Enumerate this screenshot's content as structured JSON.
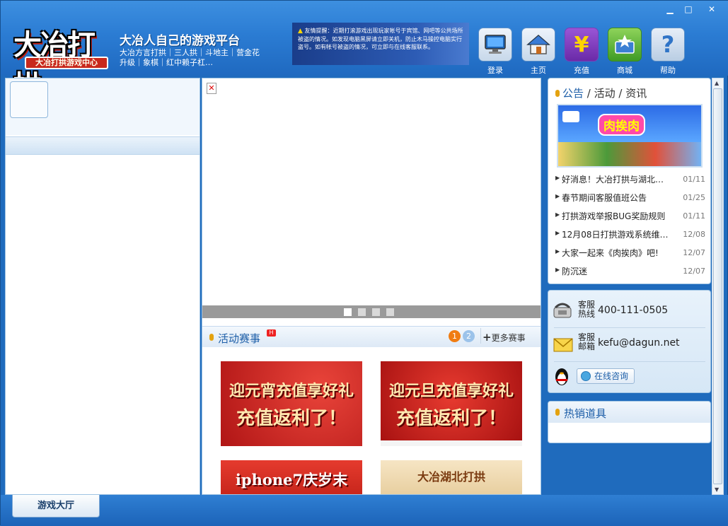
{
  "window": {
    "minimize": "▁",
    "maximize": "□",
    "close": "✕"
  },
  "header": {
    "logo_main": "大冶打拱",
    "logo_sub": "大冶打拱游戏中心",
    "slogan": "大冶人自己的游戏平台",
    "games_line1": "大冶方言打拱｜三人拱｜斗地主｜营金花",
    "games_line2": "升级｜象棋｜红中赖子杠…",
    "notice_title": "友情提醒：",
    "notice_body": "近期打滚游戏出现玩家帐号于宾馆、网吧等公共场所被盗的情况。如发现电脑黑屏请立即关机，防止木马操控电脑实行盗号。如有帐号被盗的情况，可立即与在线客服联系。"
  },
  "nav": [
    {
      "label": "登录",
      "icon": "monitor-icon"
    },
    {
      "label": "主页",
      "icon": "home-icon"
    },
    {
      "label": "充值",
      "icon": "yen-icon"
    },
    {
      "label": "商城",
      "icon": "shop-icon"
    },
    {
      "label": "帮助",
      "icon": "help-icon"
    }
  ],
  "middle": {
    "activity_title": "活动赛事",
    "hot_badge": "H",
    "page1": "1",
    "page2": "2",
    "more": "更多赛事",
    "promos": [
      {
        "line1": "迎元宵充值享好礼",
        "line2": "充值返利了！"
      },
      {
        "line1": "迎元旦充值享好礼",
        "line2": "充值返利了！"
      },
      {
        "line1": "iphone7庆岁末",
        "line2": ""
      },
      {
        "line1": "大冶湖北打拱",
        "line2": ""
      }
    ]
  },
  "right": {
    "ann_part1": "公告",
    "ann_sep1": " / ",
    "ann_part2": "活动",
    "ann_sep2": " / ",
    "ann_part3": "资讯",
    "banner_text": "肉挨肉",
    "news": [
      {
        "title": "好消息！大冶打拱与湖北…",
        "date": "01/11"
      },
      {
        "title": "春节期间客服值班公告",
        "date": "01/25"
      },
      {
        "title": "打拱游戏举报BUG奖励规则",
        "date": "01/11"
      },
      {
        "title": "12月08日打拱游戏系统维…",
        "date": "12/08"
      },
      {
        "title": "大家一起来《肉挨肉》吧!",
        "date": "12/07"
      },
      {
        "title": "防沉迷",
        "date": "12/07"
      }
    ],
    "hotline_label": "客服\n热线",
    "hotline_l1": "客服",
    "hotline_l2": "热线",
    "hotline": "400-111-0505",
    "email_l1": "客服",
    "email_l2": "邮箱",
    "email": "kefu@dagun.net",
    "consult": "在线咨询",
    "hot_items_title": "热销道具"
  },
  "bottom": {
    "hall_tab": "游戏大厅"
  }
}
